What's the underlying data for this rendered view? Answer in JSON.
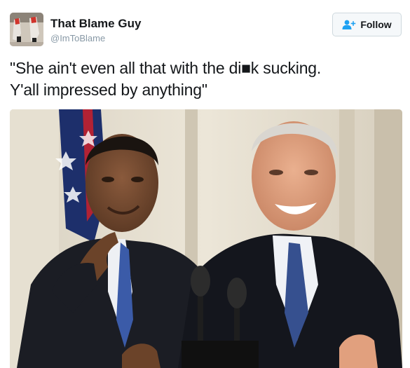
{
  "tweet": {
    "author_name": "That Blame Guy",
    "handle": "@ImToBlame",
    "follow_label": "Follow",
    "text_line1": "\"She ain't even all that with the di■k sucking.",
    "text_line2": "Y'all impressed by anything\""
  },
  "icons": {
    "follow": "add-user-icon"
  },
  "colors": {
    "name_text": "#14171a",
    "handle_text": "#8899a6",
    "follow_icon": "#1da1f2",
    "button_border": "#cfd9de",
    "button_bg": "#f5f8fa"
  }
}
